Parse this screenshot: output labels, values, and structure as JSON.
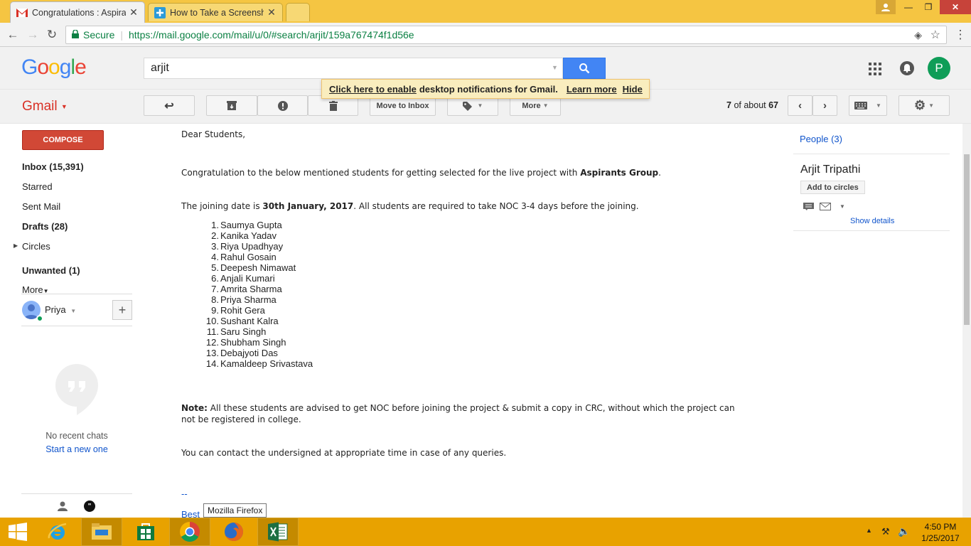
{
  "browser": {
    "tabs": [
      {
        "title": "Congratulations : Aspirants",
        "icon": "gmail-icon"
      },
      {
        "title": "How to Take a Screenshot",
        "icon": "plus-icon"
      }
    ],
    "secure_label": "Secure",
    "url": "https://mail.google.com/mail/u/0/#search/arjit/159a767474f1d56e"
  },
  "gmail": {
    "logo_text": "Google",
    "app_label": "Gmail",
    "search_value": "arjit",
    "avatar_letter": "P",
    "notification": {
      "link": "Click here to enable",
      "text": "desktop notifications for Gmail.",
      "learn_more": "Learn more",
      "hide": "Hide"
    },
    "toolbar": {
      "move_to_inbox": "Move to Inbox",
      "more": "More",
      "count_current": "7",
      "count_mid": "of about",
      "count_total": "67"
    },
    "compose": "COMPOSE",
    "nav": {
      "inbox": "Inbox (15,391)",
      "starred": "Starred",
      "sent": "Sent Mail",
      "drafts": "Drafts (28)",
      "circles": "Circles",
      "unwanted": "Unwanted (1)",
      "more": "More"
    },
    "chat": {
      "user": "Priya",
      "no_recent": "No recent chats",
      "start_new": "Start a new one"
    },
    "email": {
      "greeting": "Dear Students,",
      "congrats_pre": "Congratulation to the below mentioned students for getting selected for the live project with ",
      "congrats_bold": "Aspirants Group",
      "congrats_post": ".",
      "joining_pre": "The joining date is ",
      "joining_bold": "30th January, 2017",
      "joining_post": ". All students are required to take NOC 3-4 days before the joining.",
      "students": [
        "Saumya Gupta",
        "Kanika Yadav",
        "Riya Upadhyay",
        "Rahul Gosain",
        "Deepesh Nimawat",
        "Anjali Kumari",
        "Amrita Sharma",
        "Priya Sharma",
        "Rohit Gera",
        "Sushant Kalra",
        "Saru Singh",
        "Shubham Singh",
        "Debajyoti Das",
        "Kamaldeep Srivastava"
      ],
      "note_label": "Note:",
      "note_text": " All these students are advised to get NOC before joining the project & submit a copy in CRC, without which the project can not be registered in college.",
      "contact": "You can contact the undersigned at appropriate time in case of any queries.",
      "sig_dash": "--",
      "sig_best": "Best"
    },
    "people": {
      "header": "People (3)",
      "name": "Arjit Tripathi",
      "add_to_circles": "Add to circles",
      "show_details": "Show details"
    }
  },
  "tooltip": "Mozilla Firefox",
  "taskbar": {
    "time": "4:50 PM",
    "date": "1/25/2017"
  }
}
